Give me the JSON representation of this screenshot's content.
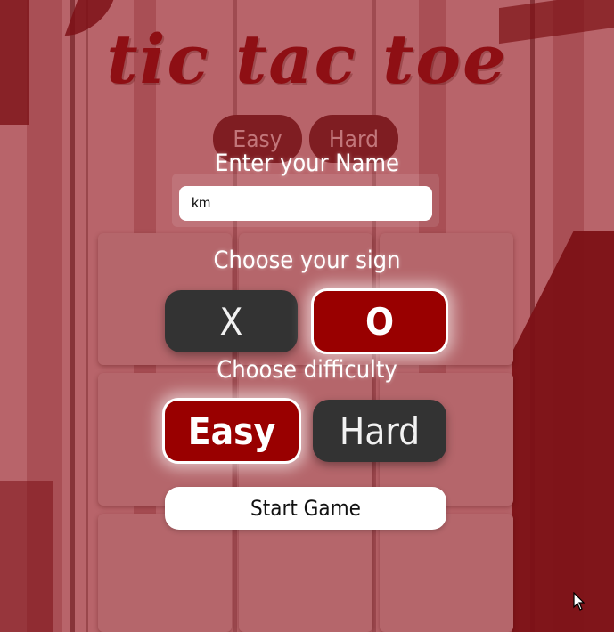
{
  "app": {
    "title": "tic tac toe"
  },
  "mode_tabs": [
    {
      "label": "Easy"
    },
    {
      "label": "Hard"
    }
  ],
  "name_form": {
    "label": "Enter your Name",
    "value": "km"
  },
  "sign": {
    "label": "Choose your sign",
    "options": [
      {
        "label": "X",
        "selected": false
      },
      {
        "label": "O",
        "selected": true
      }
    ]
  },
  "difficulty": {
    "label": "Choose difficulty",
    "options": [
      {
        "label": "Easy",
        "selected": true
      },
      {
        "label": "Hard",
        "selected": false
      }
    ]
  },
  "start_button": {
    "label": "Start Game"
  },
  "colors": {
    "accent": "#990000",
    "title": "#8e0f14",
    "dark_button": "#333333",
    "background": "#b8646a"
  }
}
